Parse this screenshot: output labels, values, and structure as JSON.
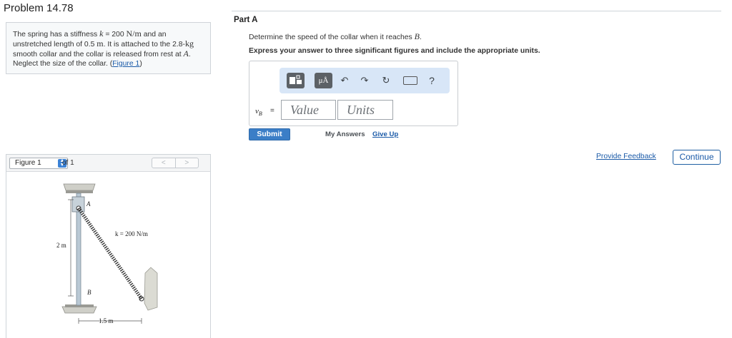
{
  "problem": {
    "title": "Problem 14.78",
    "text_1": "The spring has a stiffness ",
    "k_sym": "k",
    "text_2": " = 200 ",
    "k_unit": "N/m",
    "text_3": " and an unstretched length of 0.5 ",
    "len_unit": "m",
    "text_4": ". It is attached to the 2.8-",
    "mass_unit": "kg",
    "text_5": " smooth collar and the collar is released from rest at ",
    "point_a": "A",
    "text_6": ". Neglect the size of the collar. (",
    "figure_link": "Figure 1",
    "text_7": ")"
  },
  "figure": {
    "selected": "Figure 1",
    "of_label": "of 1",
    "prev_glyph": "<",
    "next_glyph": ">",
    "label_a": "A",
    "label_b": "B",
    "label_k": "k = 200 N/m",
    "label_height": "2 m",
    "label_width": "1.5 m"
  },
  "part": {
    "label": "Part A",
    "question_text": "Determine the speed of the collar when it reaches ",
    "question_point": "B",
    "question_end": ".",
    "instruction": "Express your answer to three significant figures and include the appropriate units."
  },
  "toolbar": {
    "units_glyph": "μÅ",
    "undo_glyph": "↶",
    "redo_glyph": "↷",
    "reset_glyph": "↻",
    "help_glyph": "?",
    "icons": [
      "templates-icon",
      "units-icon",
      "undo-icon",
      "redo-icon",
      "reset-icon",
      "keyboard-icon",
      "help-icon"
    ]
  },
  "answer": {
    "var_letter": "v",
    "var_sub": "B",
    "equals": "=",
    "value_placeholder": "Value",
    "units_placeholder": "Units"
  },
  "actions": {
    "submit": "Submit",
    "my_answers": "My Answers",
    "give_up": "Give Up",
    "feedback": "Provide Feedback",
    "continue": "Continue"
  },
  "colors": {
    "link": "#1a5aa8",
    "submit_bg": "#3b7ec7",
    "toolbar_bg": "#d8e6f7",
    "toolbar_button": "#5c6166"
  }
}
